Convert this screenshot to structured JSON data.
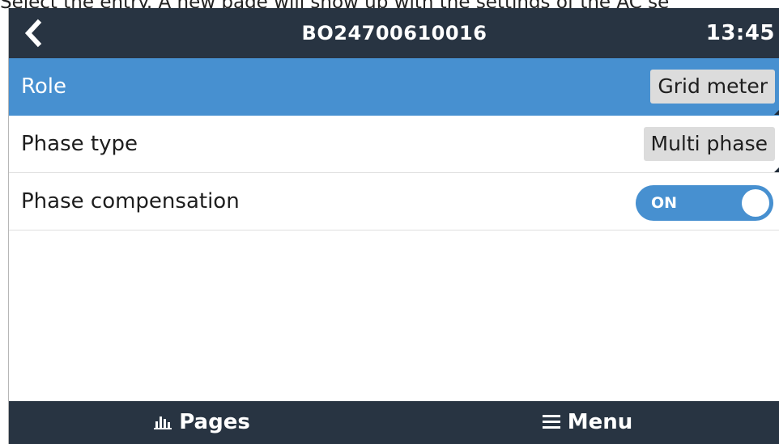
{
  "caption": "Select the entry. A new page will show up with the settings of the AC se",
  "header": {
    "title": "BO24700610016",
    "clock": "13:45",
    "back_icon": "chevron-left-icon"
  },
  "rows": [
    {
      "label": "Role",
      "value": "Grid meter",
      "selected": true
    },
    {
      "label": "Phase type",
      "value": "Multi phase",
      "selected": false
    },
    {
      "label": "Phase compensation",
      "toggle_text": "ON",
      "toggle_on": true
    }
  ],
  "footer": {
    "pages_label": "Pages",
    "pages_icon": "bar-chart-icon",
    "menu_label": "Menu",
    "menu_icon": "hamburger-menu-icon"
  },
  "colors": {
    "header_bg": "#283442",
    "accent_blue": "#4790d0",
    "value_box_bg": "#dcdcdc"
  }
}
